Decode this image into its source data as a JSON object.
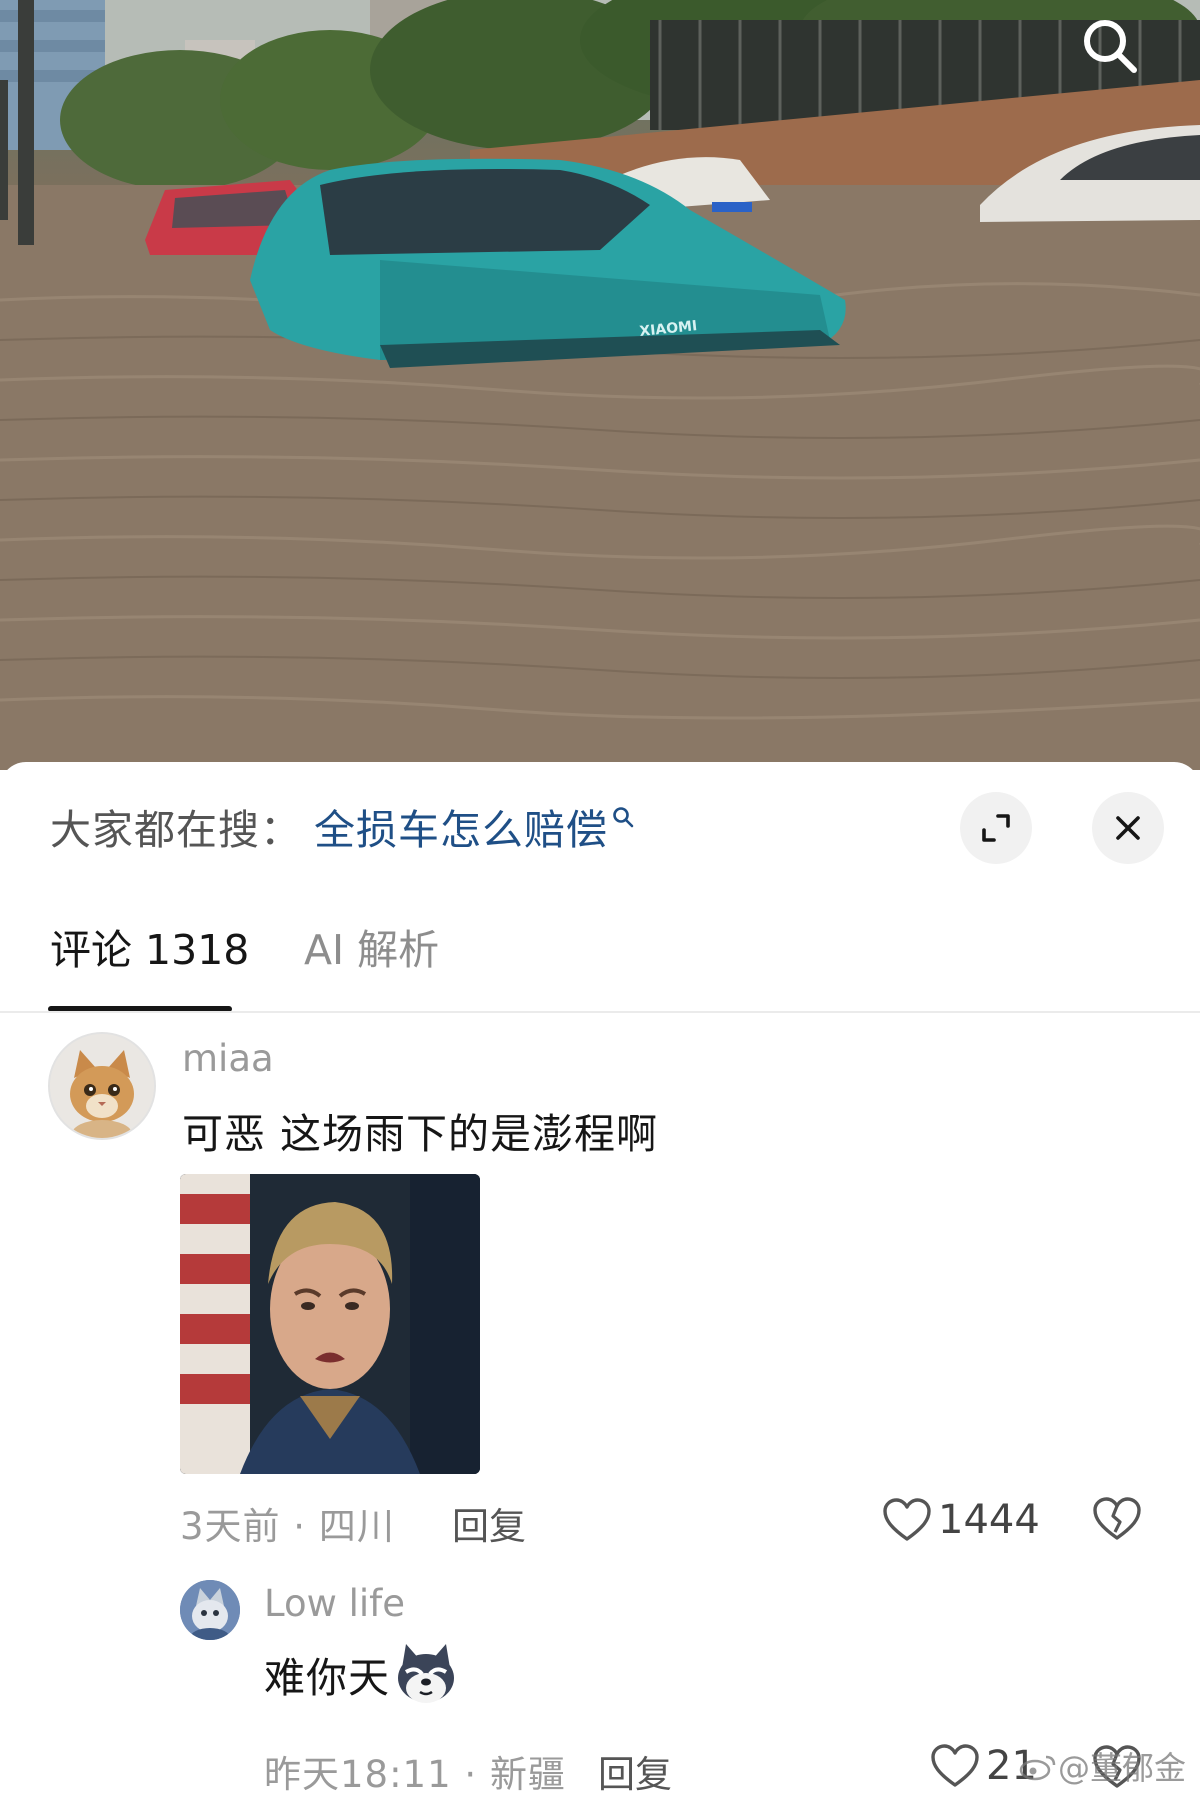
{
  "header": {
    "search_icon": "search-icon",
    "video_brand_text": "XIAOMI"
  },
  "search_suggest": {
    "prefix": "大家都在搜：",
    "query": "全损车怎么赔偿",
    "query_icon": "search-icon"
  },
  "sheet_controls": {
    "expand_icon": "expand-icon",
    "close_icon": "close-icon"
  },
  "tabs": [
    {
      "label": "评论 1318",
      "active": true
    },
    {
      "label": "AI 解析",
      "active": false
    }
  ],
  "comments": [
    {
      "username": "miaa",
      "avatar_icon": "cat-avatar",
      "text": "可恶 这场雨下的是澎程啊",
      "image": "man-crying-meme",
      "time": "3天前",
      "location": "四川",
      "meta_sep": " · ",
      "reply_label": "回复",
      "likes": "1444"
    },
    {
      "username": "Low life",
      "avatar_icon": "cat-avatar-small",
      "text": "难你天",
      "emoji": "husky-emoji",
      "time": "昨天18:11",
      "location": "新疆",
      "meta_sep": " · ",
      "reply_label": "回复",
      "likes": "21"
    }
  ],
  "watermark": "@董郁金",
  "colors": {
    "accent_query": "#1f4f86",
    "tab_active": "#161616",
    "muted": "#9a9a9a"
  }
}
